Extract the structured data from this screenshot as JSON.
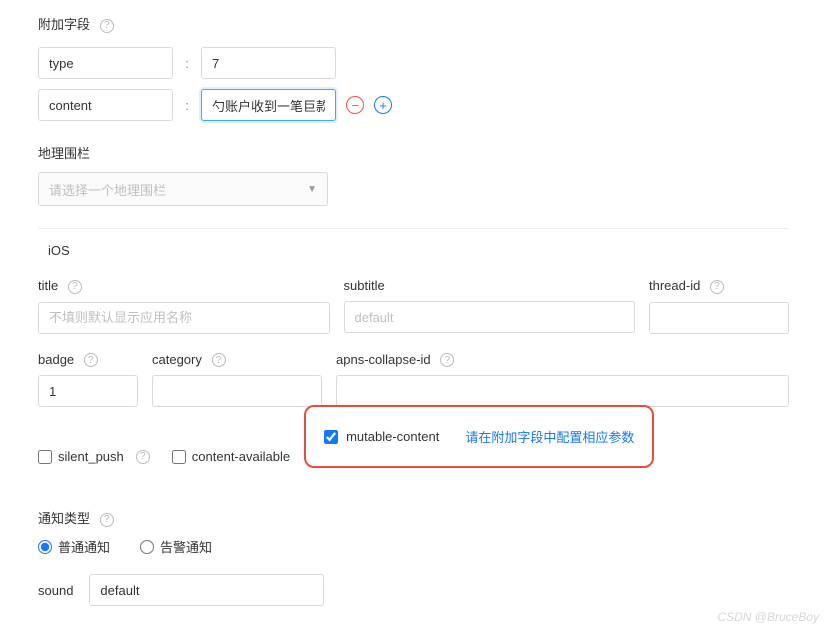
{
  "extra": {
    "label": "附加字段",
    "fields": [
      {
        "key": "type",
        "value": "7"
      },
      {
        "key": "content",
        "value": "勺账户收到一笔巨款"
      }
    ]
  },
  "geofence": {
    "label": "地理围栏",
    "placeholder": "请选择一个地理围栏"
  },
  "platform": {
    "name": "iOS"
  },
  "ios": {
    "title": {
      "label": "title",
      "placeholder": "不填则默认显示应用名称",
      "value": ""
    },
    "subtitle": {
      "label": "subtitle",
      "placeholder": "default",
      "value": ""
    },
    "threadId": {
      "label": "thread-id",
      "value": ""
    },
    "badge": {
      "label": "badge",
      "value": "1"
    },
    "category": {
      "label": "category",
      "value": ""
    },
    "apnsCollapse": {
      "label": "apns-collapse-id",
      "value": ""
    },
    "silentPush": {
      "label": "silent_push",
      "checked": false
    },
    "contentAvailable": {
      "label": "content-available",
      "checked": false
    },
    "mutableContent": {
      "label": "mutable-content",
      "checked": true,
      "hint": "请在附加字段中配置相应参数"
    },
    "notifyType": {
      "label": "通知类型",
      "options": {
        "normal": "普通通知",
        "alert": "告警通知"
      },
      "selected": "normal"
    },
    "sound": {
      "label": "sound",
      "value": "default"
    }
  },
  "watermark": "CSDN @BruceBoy"
}
